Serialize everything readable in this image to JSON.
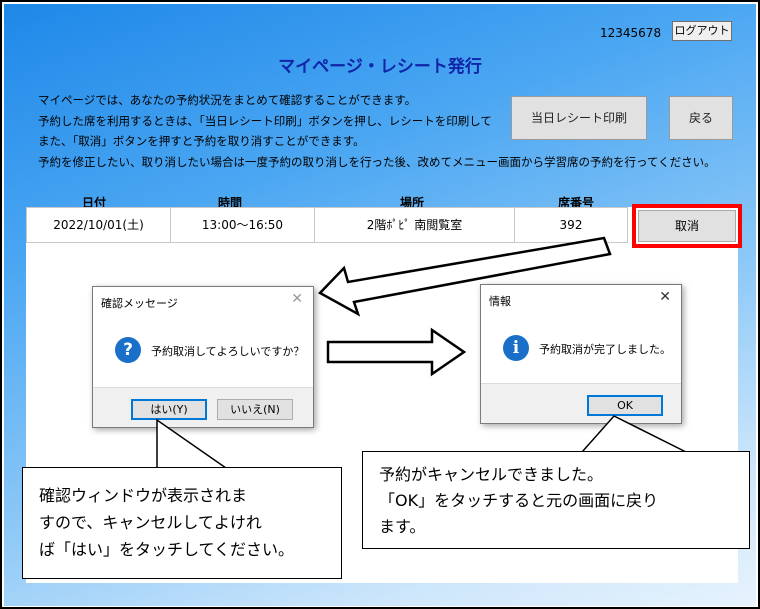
{
  "header": {
    "user_id": "12345678",
    "logout_label": "ログアウト",
    "title": "マイページ・レシート発行"
  },
  "description": [
    "マイページでは、あなたの予約状況をまとめて確認することができます。",
    "予約した席を利用するときは、「当日レシート印刷」ボタンを押し、レシートを印刷して",
    "また、「取消」ボタンを押すと予約を取り消すことができます。",
    "予約を修正したい、取り消したい場合は一度予約の取り消しを行った後、改めてメニュー画面から学習席の予約を行ってください。"
  ],
  "buttons": {
    "print_receipt": "当日レシート印刷",
    "back": "戻る",
    "cancel": "取消"
  },
  "table": {
    "headers": [
      "日付",
      "時間",
      "場所",
      "席番号"
    ],
    "rows": [
      {
        "date": "2022/10/01(土)",
        "time": "13:00〜16:50",
        "place": "2階ﾎﾟﾋﾟ  南閲覧室",
        "seat": "392"
      }
    ]
  },
  "confirm_dialog": {
    "title": "確認メッセージ",
    "message": "予約取消してよろしいですか？",
    "yes_label": "はい(Y)",
    "no_label": "いいえ(N)",
    "icon": "question-icon"
  },
  "info_dialog": {
    "title": "情報",
    "message": "予約取消が完了しました。",
    "ok_label": "OK",
    "icon": "info-icon"
  },
  "callouts": {
    "left": [
      "確認ウィンドウが表示されま",
      "すので、キャンセルしてよけれ",
      "ば「はい」をタッチしてください。"
    ],
    "right": [
      "予約がキャンセルできました。",
      "「OK」をタッチすると元の画面に戻り",
      "ます。"
    ]
  },
  "colors": {
    "title": "#1024a8",
    "highlight": "#ff0000",
    "background_top": "#1e88e8",
    "background_bottom": "#e6f3fd"
  }
}
